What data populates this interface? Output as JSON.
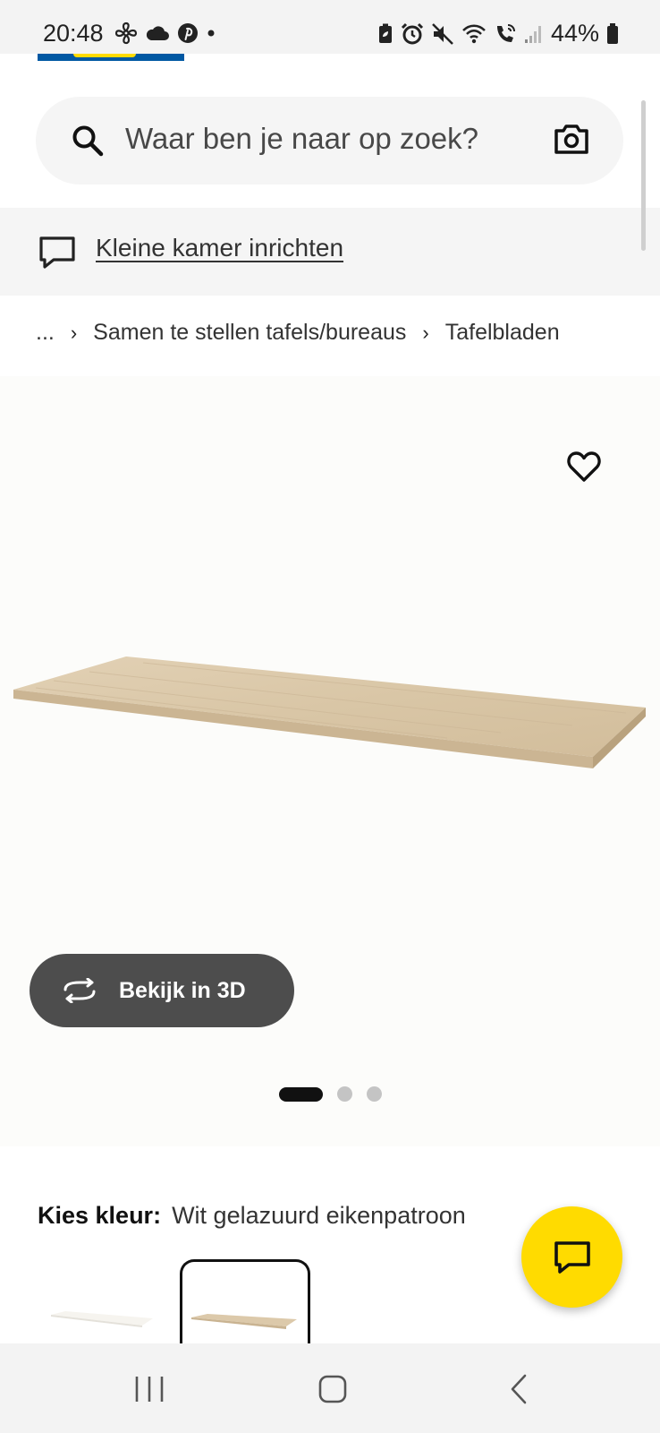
{
  "status_bar": {
    "time": "20:48",
    "battery": "44%",
    "left_icons": [
      "fan-icon",
      "cloud-icon",
      "pinterest-icon",
      "dot-icon"
    ],
    "right_icons": [
      "battery-saver-icon",
      "alarm-icon",
      "mute-icon",
      "wifi-icon",
      "wifi-call-icon",
      "signal-icon",
      "battery-icon"
    ]
  },
  "search": {
    "placeholder": "Waar ben je naar op zoek?",
    "search_icon": "search-icon",
    "camera_icon": "camera-icon"
  },
  "banner": {
    "icon": "chat-bubble-icon",
    "link_text": "Kleine kamer inrichten"
  },
  "breadcrumb": {
    "items": [
      "...",
      "Samen te stellen tafels/bureaus",
      "Tafelbladen"
    ],
    "separator": "›"
  },
  "product": {
    "favorite_icon": "heart-icon",
    "view_3d_label": "Bekijk in 3D",
    "view_3d_icon": "rotate-icon",
    "image_count": 3,
    "active_image": 1
  },
  "color": {
    "label": "Kies kleur:",
    "value": "Wit gelazuurd eikenpatroon",
    "swatches": [
      {
        "name": "white",
        "selected": false
      },
      {
        "name": "white-stained-oak",
        "selected": true
      }
    ]
  },
  "chat_fab": {
    "icon": "chat-icon"
  },
  "colors": {
    "accent_yellow": "#ffdb00",
    "brand_blue": "#0058a3",
    "button_dark": "#4d4d4d"
  },
  "nav_bar": {
    "icons": [
      "recents-icon",
      "home-icon",
      "back-icon"
    ]
  }
}
